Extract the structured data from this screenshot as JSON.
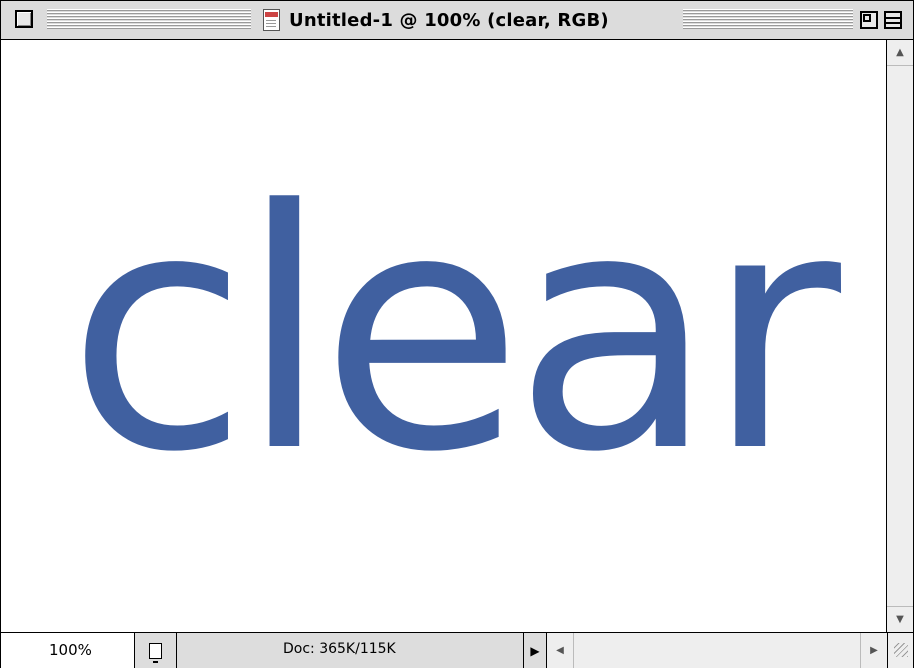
{
  "window": {
    "title": "Untitled-1 @ 100% (clear, RGB)",
    "icons": {
      "close": "close-box-icon",
      "document": "photoshop-document-icon",
      "zoom": "zoom-box-icon",
      "collapse": "collapse-box-icon"
    }
  },
  "canvas": {
    "layer_text": "clear",
    "text_color": "#4060a0",
    "background": "#ffffff"
  },
  "status_bar": {
    "zoom_level": "100%",
    "doc_size": "Doc: 365K/115K",
    "icons": {
      "page": "page-preview-icon",
      "status_menu": "triangle-right-icon"
    }
  },
  "scrollbars": {
    "vertical": {
      "up": "▲",
      "down": "▼"
    },
    "horizontal": {
      "left": "◀",
      "right": "▶"
    }
  }
}
